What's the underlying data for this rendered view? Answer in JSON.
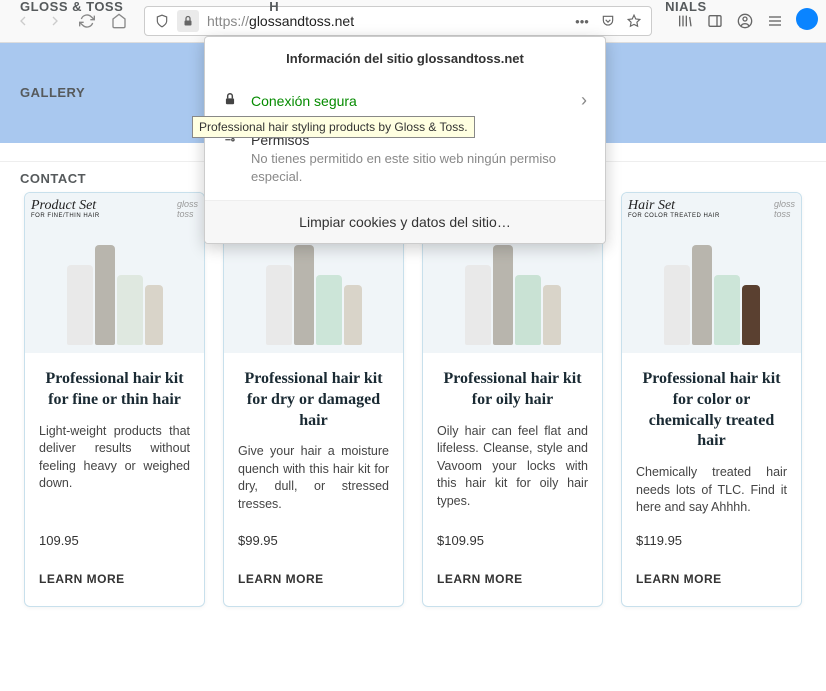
{
  "browser": {
    "url_protocol": "https://",
    "url_domain": "glossandtoss.net"
  },
  "nav": {
    "items": [
      "GLOSS & TOSS",
      "H",
      "NIALS",
      "GALLERY",
      "CONTACT"
    ]
  },
  "popup": {
    "title": "Información del sitio glossandtoss.net",
    "secure": "Conexión segura",
    "permissions": "Permisos",
    "permissions_text": "No tienes permitido en este sitio web ningún permiso especial.",
    "clear": "Limpiar cookies y datos del sitio…"
  },
  "tooltip": "Professional hair styling products by Gloss & Toss.",
  "products": [
    {
      "tag": "Product Set",
      "tag_sub": "FOR FINE/THIN HAIR",
      "title": "Professional hair kit for fine or thin hair",
      "desc": "Light-weight products that deliver results without feeling heavy or weighed down.",
      "price": "109.95",
      "cta": "LEARN MORE"
    },
    {
      "tag": "",
      "tag_sub": "",
      "title": "Professional hair kit for dry or damaged hair",
      "desc": "Give your hair a moisture quench with this hair kit for dry, dull, or stressed tresses.",
      "price": "$99.95",
      "cta": "LEARN MORE"
    },
    {
      "tag": "",
      "tag_sub": "",
      "title": "Professional hair kit for oily hair",
      "desc": "Oily hair can feel flat and lifeless. Cleanse, style and Vavoom your locks with this hair kit for oily hair types.",
      "price": "$109.95",
      "cta": "LEARN MORE"
    },
    {
      "tag": "Hair Set",
      "tag_sub": "FOR COLOR TREATED HAIR",
      "title": "Professional hair kit for color or chemically treated hair",
      "desc": "Chemically treated hair needs lots of TLC. Find it here and say Ahhhh.",
      "price": "$119.95",
      "cta": "LEARN MORE"
    }
  ]
}
